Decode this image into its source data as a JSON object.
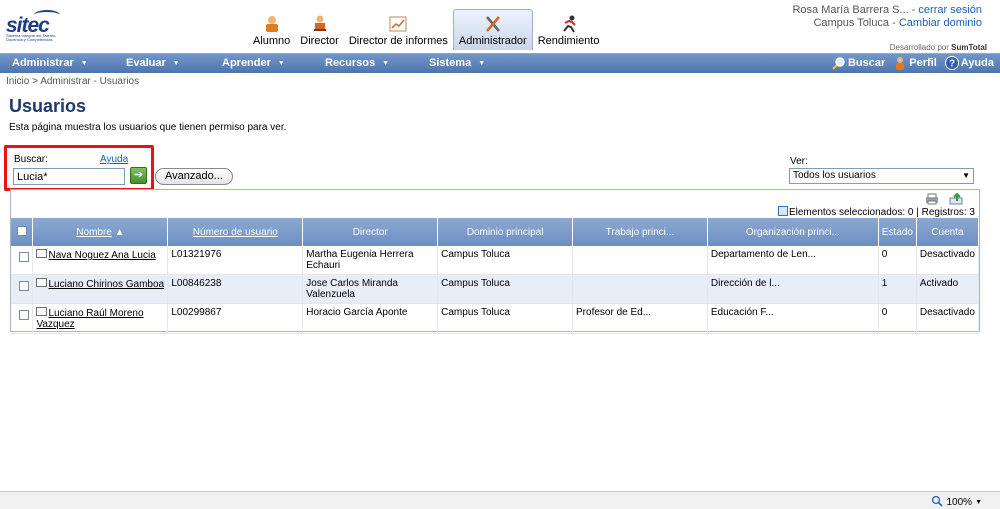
{
  "header": {
    "logo": {
      "word": "sitec",
      "tagline": "Sistema Integral del Talento, Docencia y Competencias"
    },
    "roles": [
      {
        "label": "Alumno",
        "icon": "student-icon",
        "active": false
      },
      {
        "label": "Director",
        "icon": "director-chair-icon",
        "active": false
      },
      {
        "label": "Director de informes",
        "icon": "report-chart-icon",
        "active": false
      },
      {
        "label": "Administrador",
        "icon": "admin-tools-icon",
        "active": true
      },
      {
        "label": "Rendimiento",
        "icon": "performance-runner-icon",
        "active": false
      }
    ],
    "user": {
      "name": "Rosa María Barrera S...",
      "separator": " - ",
      "logout": "cerrar sesión",
      "domain": "Campus Toluca",
      "change_domain": "Cambiar dominio"
    },
    "developed_by": {
      "prefix": "Desarrollado por",
      "brand": "SumTotal"
    }
  },
  "nav": {
    "items": [
      "Administrar",
      "Evaluar",
      "Aprender",
      "Recursos",
      "Sistema"
    ],
    "right": [
      {
        "label": "Buscar",
        "icon": "search-icon"
      },
      {
        "label": "Perfil",
        "icon": "profile-icon"
      },
      {
        "label": "Ayuda",
        "icon": "help-icon"
      }
    ]
  },
  "breadcrumb": "Inicio > Administrar - Usuarios",
  "page": {
    "title": "Usuarios",
    "description": "Esta página muestra los usuarios que tienen permiso para ver."
  },
  "search": {
    "label": "Buscar:",
    "help": "Ayuda",
    "value": "Lucia*",
    "advanced": "Avanzado...",
    "view_label": "Ver:",
    "view_value": "Todos los usuarios"
  },
  "grid": {
    "selected_label": "Elementos seleccionados: 0 | Registros: 3",
    "columns": [
      "Nombre",
      "Número de usuario",
      "Director",
      "Dominio principal",
      "Trabajo princi...",
      "Organización princi...",
      "Estado",
      "Cuenta"
    ],
    "rows": [
      {
        "name": "Nava Noguez Ana Lucia",
        "number": "L01321976",
        "director": "Martha Eugenia Herrera Echauri",
        "domain": "Campus Toluca",
        "job": "",
        "org": "Departamento de Len...",
        "state": "0",
        "account": "Desactivado"
      },
      {
        "name": "Luciano Chirinos Gamboa",
        "number": "L00846238",
        "director": "Jose Carlos Miranda Valenzuela",
        "domain": "Campus Toluca",
        "job": "",
        "org": "Dirección de l...",
        "state": "1",
        "account": "Activado"
      },
      {
        "name": "Luciano Raúl Moreno Vazquez",
        "number": "L00299867",
        "director": "Horacio García Aponte",
        "domain": "Campus Toluca",
        "job": "Profesor de Ed...",
        "org": "Educación F...",
        "state": "0",
        "account": "Desactivado"
      }
    ]
  },
  "statusbar": {
    "zoom": "100%"
  },
  "colors": {
    "accent": "#1b3a6f",
    "nav": "#5b80b8",
    "highlight": "#ee1111",
    "link": "#1e5fb4"
  }
}
